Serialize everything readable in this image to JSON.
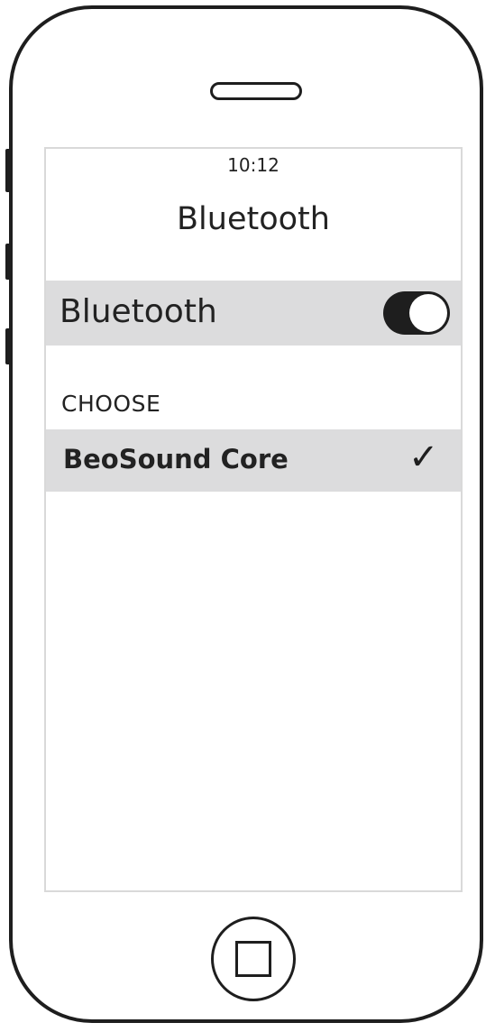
{
  "status_bar": {
    "time": "10:12"
  },
  "nav_bar": {
    "title": "Bluetooth"
  },
  "bluetooth_setting": {
    "label": "Bluetooth",
    "toggle_on": true
  },
  "devices_section": {
    "header": "CHOOSE",
    "items": [
      {
        "name": "BeoSound Core",
        "selected": true,
        "selected_mark": "✓"
      }
    ]
  },
  "icons": {
    "toggle": "toggle-switch-icon",
    "check": "checkmark-icon",
    "home": "home-button-icon"
  },
  "colors": {
    "row_background": "#dcdcdd",
    "outline": "#1e1e1e",
    "screen_border": "#d9d9d9"
  }
}
